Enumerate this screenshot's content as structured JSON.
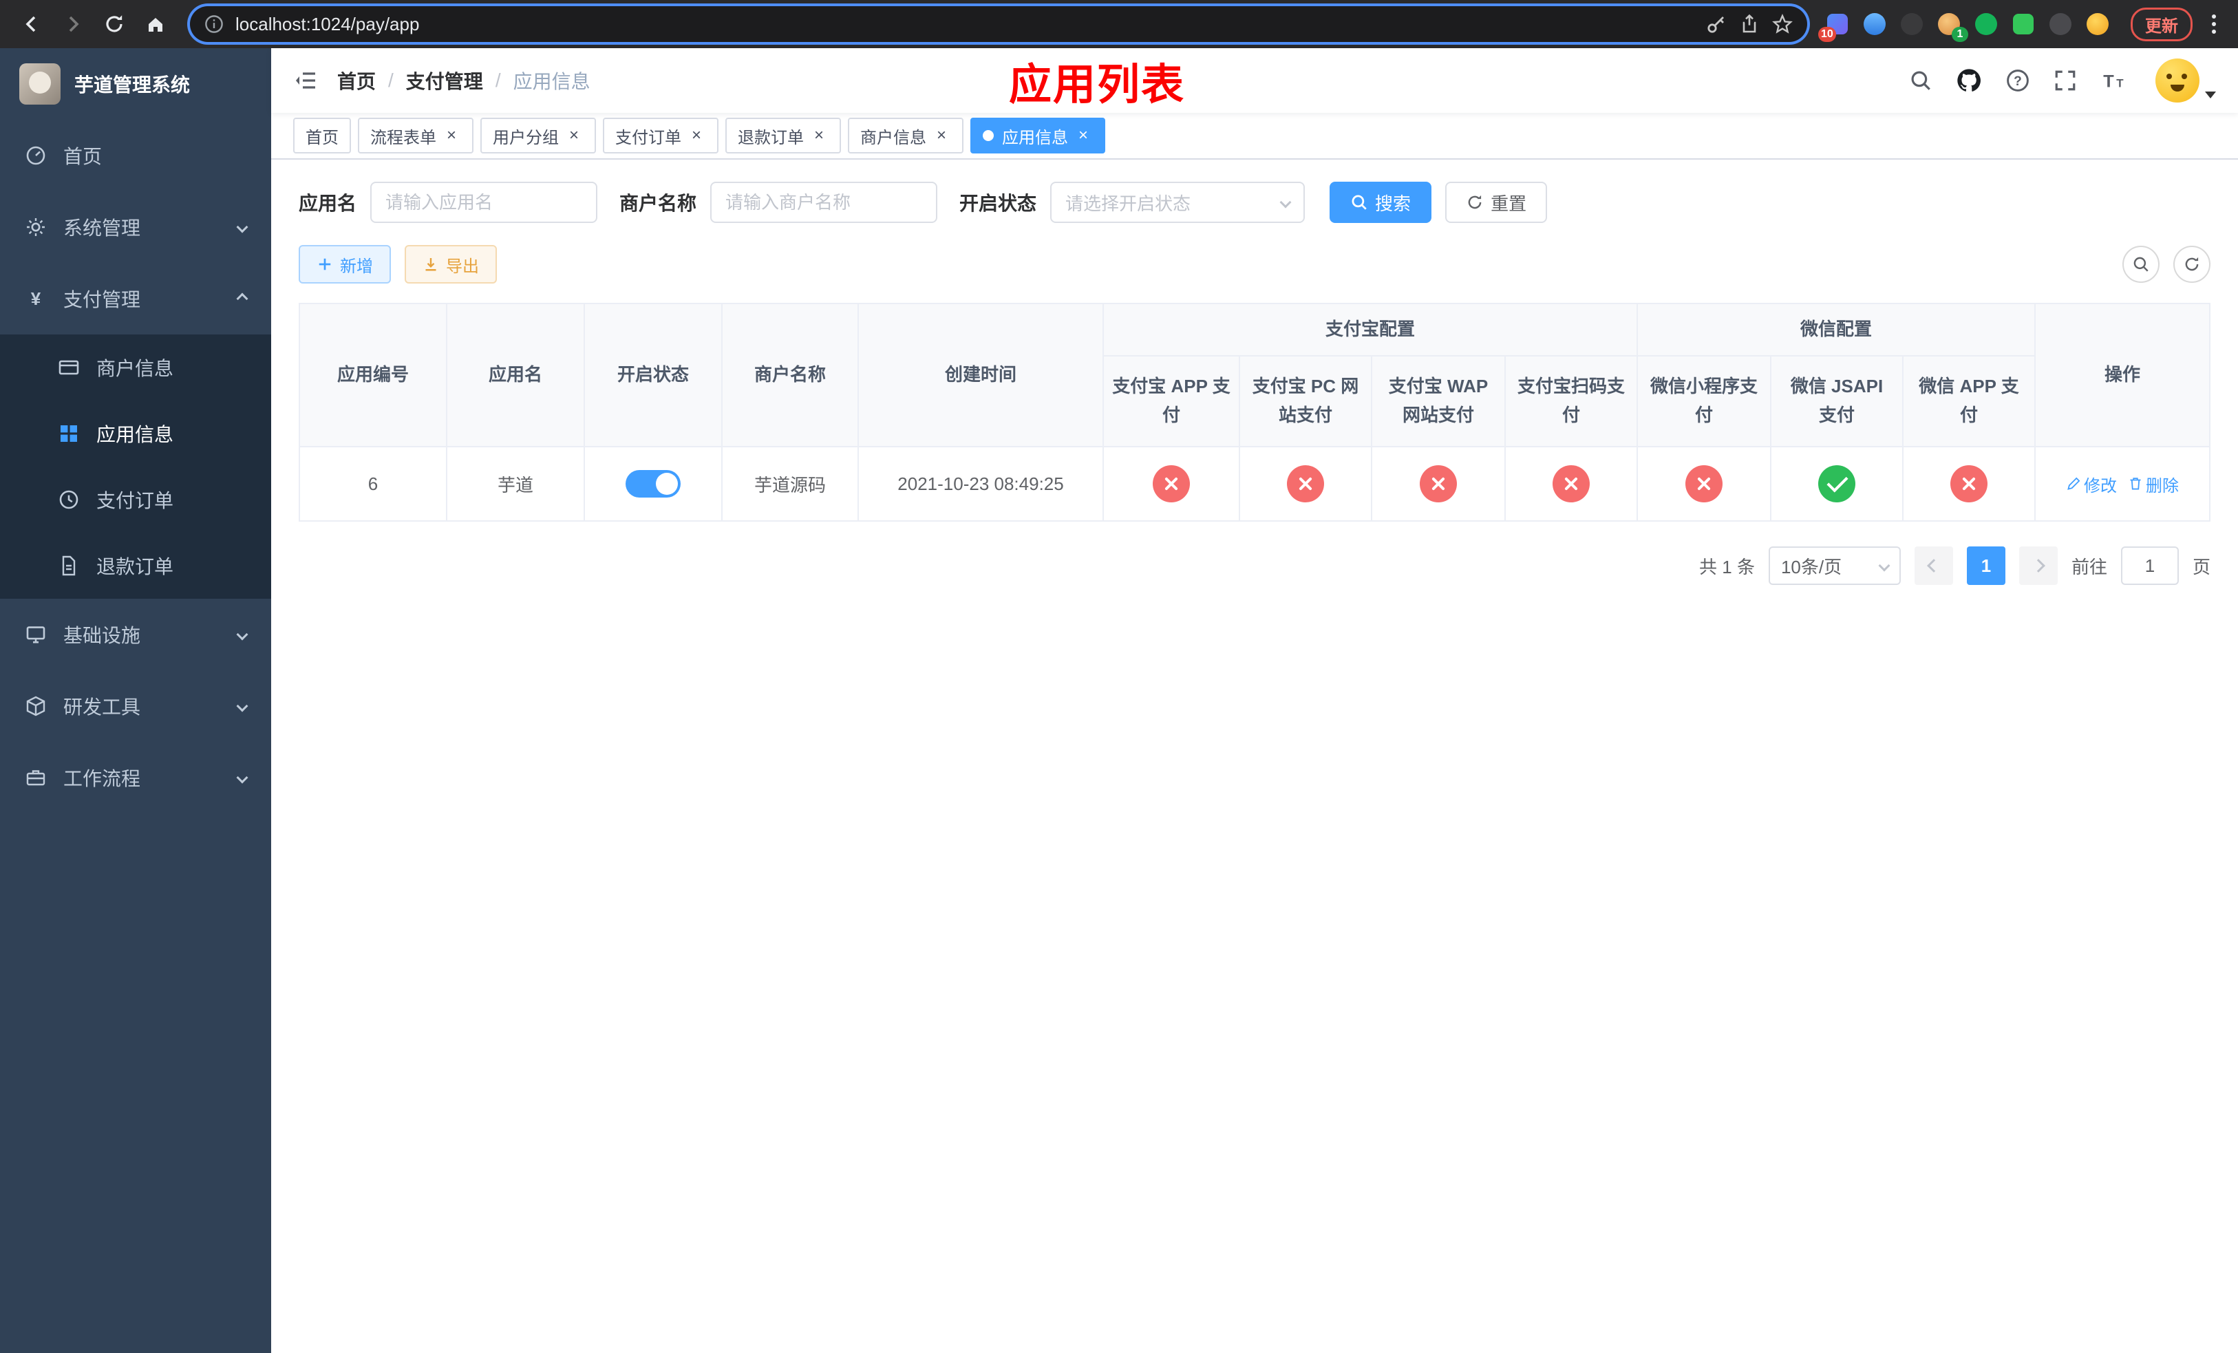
{
  "browser": {
    "url": "localhost:1024/pay/app",
    "update_label": "更新",
    "badge_ext": "10",
    "badge_avatar": "1"
  },
  "sidebar": {
    "title": "芋道管理系统",
    "home": "首页",
    "system": "系统管理",
    "payment": "支付管理",
    "merchant_info": "商户信息",
    "app_info": "应用信息",
    "pay_order": "支付订单",
    "refund_order": "退款订单",
    "infra": "基础设施",
    "dev_tools": "研发工具",
    "workflow": "工作流程"
  },
  "header": {
    "breadcrumb_home": "首页",
    "breadcrumb_section": "支付管理",
    "breadcrumb_current": "应用信息",
    "annotation": "应用列表"
  },
  "tabs": [
    {
      "label": "首页"
    },
    {
      "label": "流程表单"
    },
    {
      "label": "用户分组"
    },
    {
      "label": "支付订单"
    },
    {
      "label": "退款订单"
    },
    {
      "label": "商户信息"
    },
    {
      "label": "应用信息"
    }
  ],
  "filters": {
    "app_name_label": "应用名",
    "app_name_placeholder": "请输入应用名",
    "merchant_label": "商户名称",
    "merchant_placeholder": "请输入商户名称",
    "status_label": "开启状态",
    "status_placeholder": "请选择开启状态",
    "search_label": "搜索",
    "reset_label": "重置"
  },
  "toolbar": {
    "add_label": "新增",
    "export_label": "导出"
  },
  "table": {
    "headers": {
      "id": "应用编号",
      "name": "应用名",
      "status": "开启状态",
      "merchant": "商户名称",
      "created": "创建时间",
      "alipay_group": "支付宝配置",
      "wechat_group": "微信配置",
      "alipay_app": "支付宝 APP 支付",
      "alipay_pc": "支付宝 PC 网站支付",
      "alipay_wap": "支付宝 WAP 网站支付",
      "alipay_qr": "支付宝扫码支付",
      "wx_mini": "微信小程序支付",
      "wx_jsapi": "微信 JSAPI 支付",
      "wx_app": "微信 APP 支付",
      "actions": "操作"
    },
    "rows": [
      {
        "id": "6",
        "name": "芋道",
        "enabled": true,
        "merchant": "芋道源码",
        "created": "2021-10-23 08:49:25",
        "alipay_app": false,
        "alipay_pc": false,
        "alipay_wap": false,
        "alipay_qr": false,
        "wx_mini": false,
        "wx_jsapi": true,
        "wx_app": false,
        "edit_label": "修改",
        "delete_label": "删除"
      }
    ]
  },
  "pagination": {
    "total": "共 1 条",
    "page_size": "10条/页",
    "page": "1",
    "goto": "前往",
    "unit": "页",
    "goto_value": "1"
  }
}
